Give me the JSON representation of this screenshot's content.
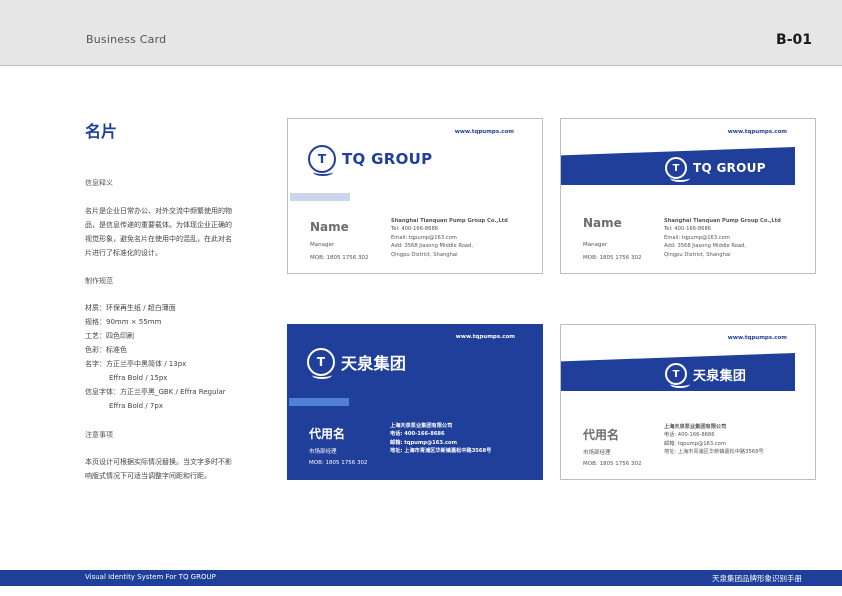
{
  "header": {
    "title": "Business Card",
    "code": "B-01"
  },
  "section": {
    "title": "名片",
    "intro_heading": "信息释义",
    "intro_lines": [
      "名片是企业日常办公、对外交流中频繁使用的物",
      "品，是信息传递的重要载体。为体现企业正确的",
      "视觉形象，避免名片在使用中的混乱，在此对名",
      "片进行了标准化的设计。"
    ],
    "spec_heading": "制作规范",
    "specs": [
      "材质：环保再生纸 / 超白薄面",
      "规格：90mm × 55mm",
      "工艺：四色印刷",
      "色彩：标准色",
      "名字：方正兰亭中黑简体 / 13px",
      "Effra Bold / 15px",
      "信息字体：方正兰亭黑_GBK / Effra Regular",
      "Effra Bold / 7px"
    ],
    "notes_heading": "注意事项",
    "notes_lines": [
      "本页设计可根据实际情况替换。当文字多时不影",
      "响版式情况下可适当调整字间距和行距。"
    ]
  },
  "cards": {
    "url": "www.tqpumps.com",
    "en": {
      "logo_mark": "T",
      "logo_text": "TQ GROUP",
      "name": "Name",
      "role": "Manager",
      "mob": "MOB: 1805 1756 302",
      "company": "Shanghai Tianquan Pump Group Co.,Ltd",
      "tel": "Tel: 400-166-8686",
      "email": "Email: tqpump@163.com",
      "addr1": "Add: 3568 Jiasong Middle Road,",
      "addr2": "Qingpu District, Shanghai"
    },
    "en2": {
      "addr1": "Add: 3568 Jiasong Middle Road,"
    },
    "cn": {
      "logo_mark": "T",
      "logo_text": "天泉集团",
      "name": "代用名",
      "role": "市场部经理",
      "mob": "MOB: 1805 1756 302",
      "company": "上海天泉泵业集团有限公司",
      "tel": "电话: 400-166-8686",
      "email": "邮箱: tqpump@163.com",
      "addr": "地址: 上海市青浦区华新镇嘉松中路3568号"
    },
    "colors": {
      "brand_blue": "#1f3f9a",
      "stripe_light": "#c9d6ec",
      "stripe_blue": "#4f7fd6"
    }
  },
  "footer": {
    "left": "Visual Identity System For TQ GROUP",
    "right": "天泉集团品牌形象识别手册"
  }
}
